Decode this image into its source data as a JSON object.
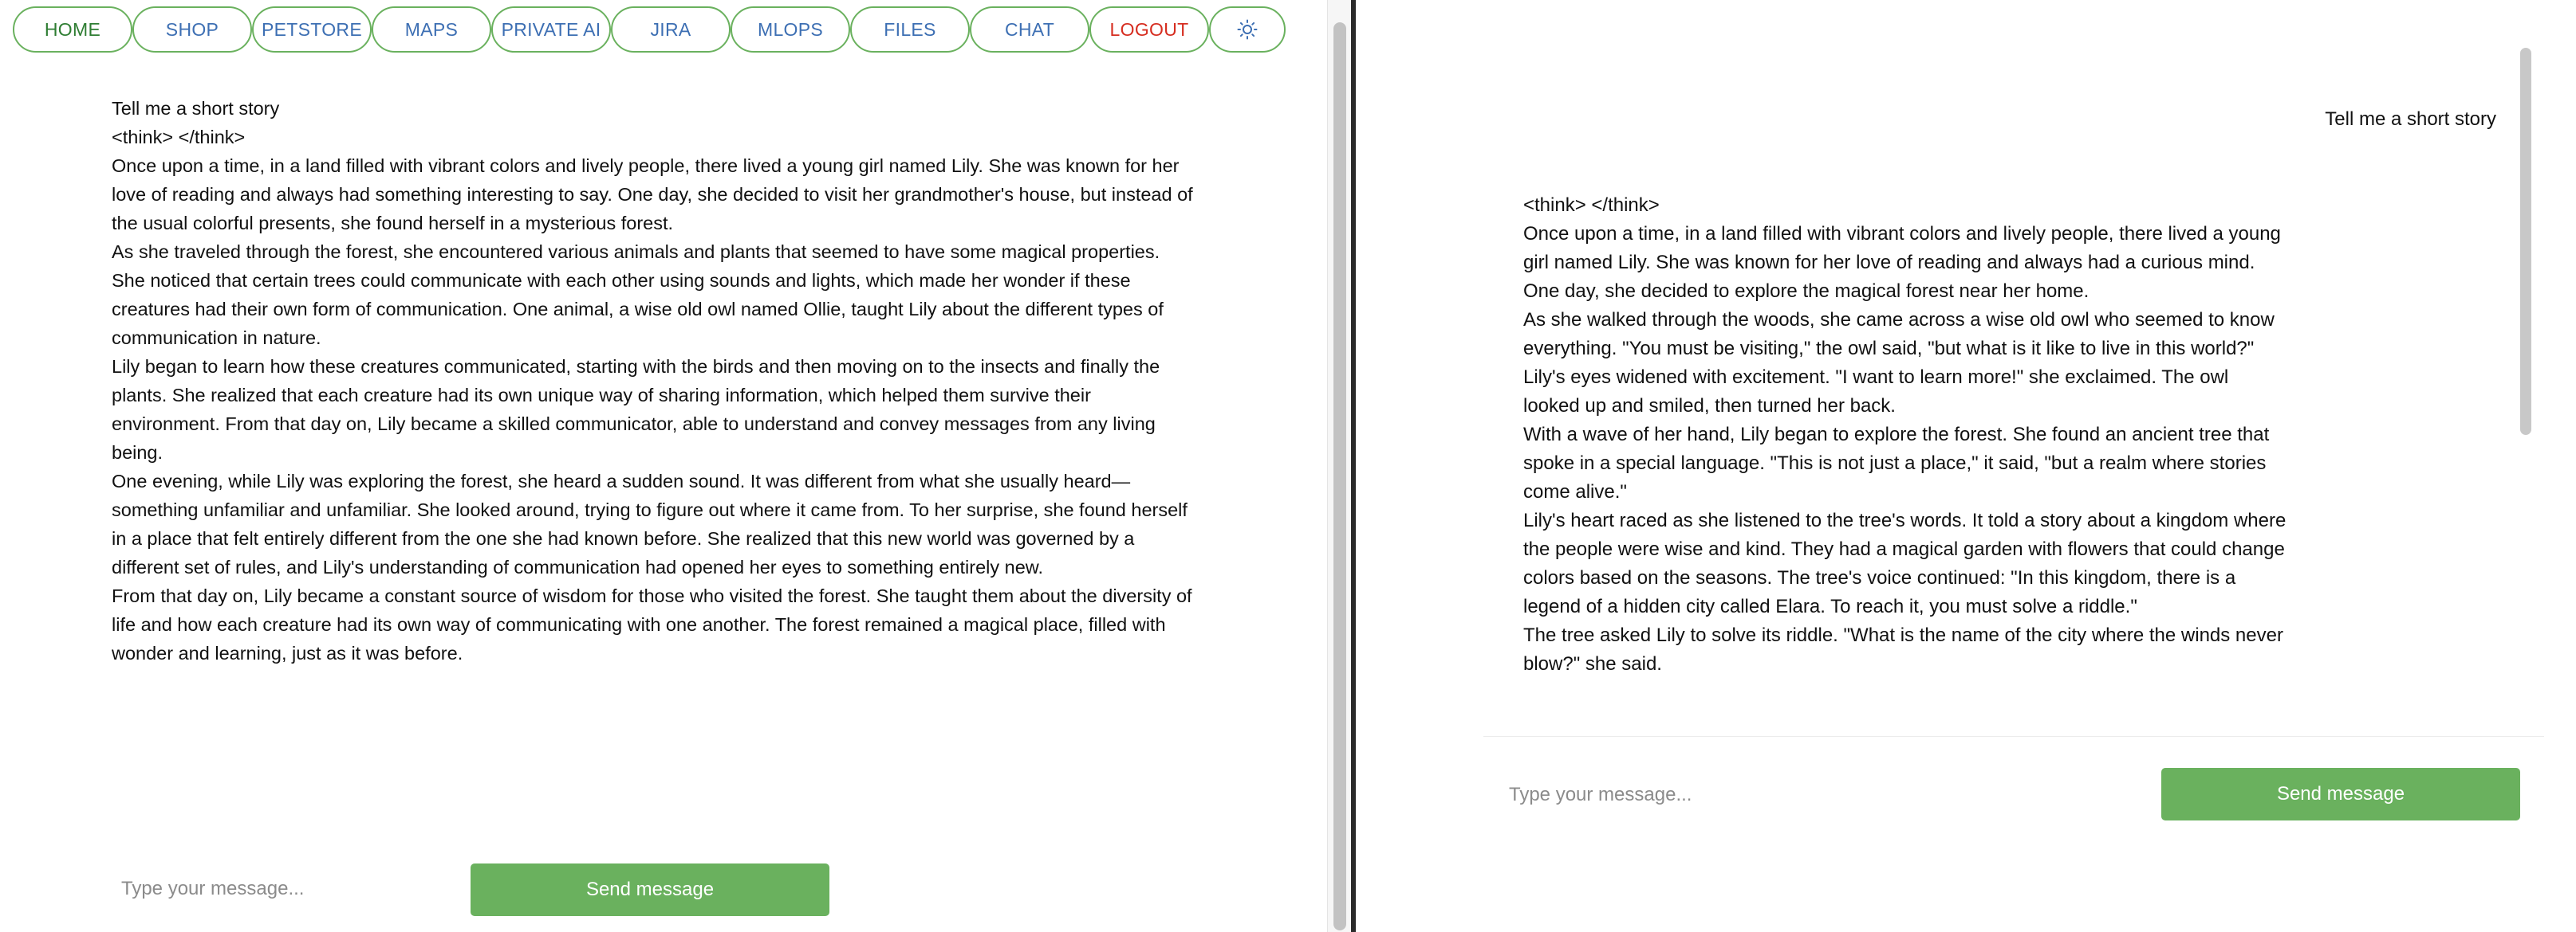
{
  "nav": {
    "items": [
      {
        "label": "HOME"
      },
      {
        "label": "SHOP"
      },
      {
        "label": "PETSTORE"
      },
      {
        "label": "MAPS"
      },
      {
        "label": "PRIVATE AI"
      },
      {
        "label": "JIRA"
      },
      {
        "label": "MLOPS"
      },
      {
        "label": "FILES"
      },
      {
        "label": "CHAT"
      },
      {
        "label": "LOGOUT"
      }
    ],
    "theme_icon": "sun-icon",
    "colors": {
      "border": "#6ab15e",
      "link": "#3d6fb3",
      "home": "#2e7d32",
      "logout": "#d62d20"
    }
  },
  "left_chat": {
    "user_prompt": "Tell me a short story",
    "think": "<think> </think>",
    "paragraphs": [
      "Once upon a time, in a land filled with vibrant colors and lively people, there lived a young girl named Lily. She was known for her love of reading and always had something interesting to say. One day, she decided to visit her grandmother's house, but instead of the usual colorful presents, she found herself in a mysterious forest.",
      "As she traveled through the forest, she encountered various animals and plants that seemed to have some magical properties. She noticed that certain trees could communicate with each other using sounds and lights, which made her wonder if these creatures had their own form of communication. One animal, a wise old owl named Ollie, taught Lily about the different types of communication in nature.",
      "Lily began to learn how these creatures communicated, starting with the birds and then moving on to the insects and finally the plants. She realized that each creature had its own unique way of sharing information, which helped them survive their environment. From that day on, Lily became a skilled communicator, able to understand and convey messages from any living being.",
      "One evening, while Lily was exploring the forest, she heard a sudden sound. It was different from what she usually heard—something unfamiliar and unfamiliar. She looked around, trying to figure out where it came from. To her surprise, she found herself in a place that felt entirely different from the one she had known before. She realized that this new world was governed by a different set of rules, and Lily's understanding of communication had opened her eyes to something entirely new.",
      "From that day on, Lily became a constant source of wisdom for those who visited the forest. She taught them about the diversity of life and how each creature had its own way of communicating with one another. The forest remained a magical place, filled with wonder and learning, just as it was before."
    ],
    "input_placeholder": "Type your message...",
    "send_label": "Send message"
  },
  "right_chat": {
    "user_prompt": "Tell me a short story",
    "think": "<think> </think>",
    "paragraphs": [
      "Once upon a time, in a land filled with vibrant colors and lively people, there lived a young girl named Lily. She was known for her love of reading and always had a curious mind. One day, she decided to explore the magical forest near her home.",
      "As she walked through the woods, she came across a wise old owl who seemed to know everything. \"You must be visiting,\" the owl said, \"but what is it like to live in this world?\"",
      "Lily's eyes widened with excitement. \"I want to learn more!\" she exclaimed. The owl looked up and smiled, then turned her back.",
      "With a wave of her hand, Lily began to explore the forest. She found an ancient tree that spoke in a special language. \"This is not just a place,\" it said, \"but a realm where stories come alive.\"",
      "Lily's heart raced as she listened to the tree's words. It told a story about a kingdom where the people were wise and kind. They had a magical garden with flowers that could change colors based on the seasons. The tree's voice continued: \"In this kingdom, there is a legend of a hidden city called Elara. To reach it, you must solve a riddle.\"",
      "The tree asked Lily to solve its riddle. \"What is the name of the city where the winds never blow?\" she said."
    ],
    "input_placeholder": "Type your message...",
    "send_label": "Send message"
  },
  "accent_color": "#6ab15e"
}
